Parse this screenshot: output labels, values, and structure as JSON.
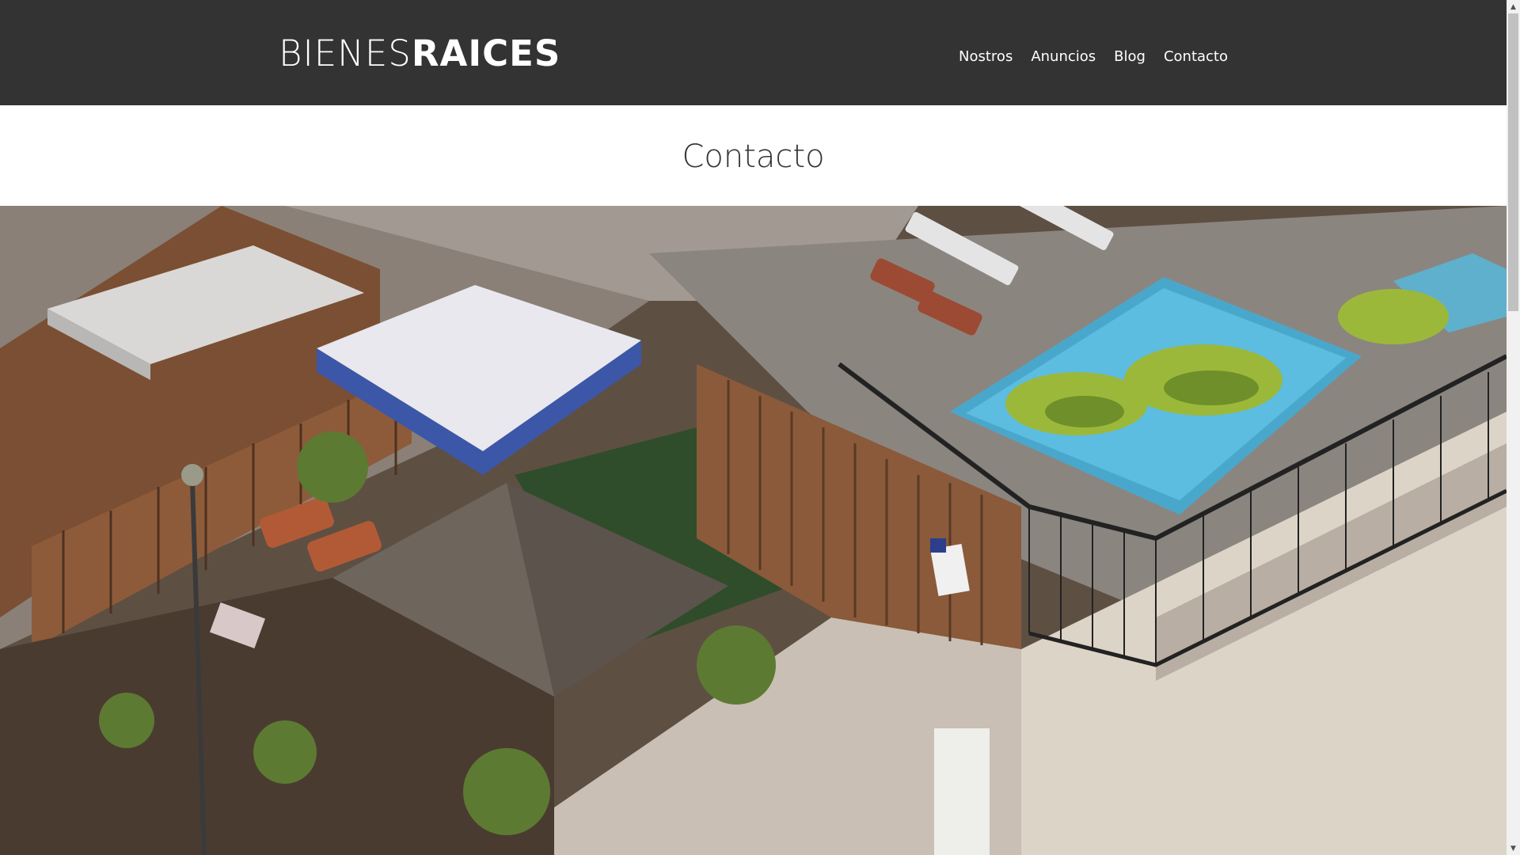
{
  "header": {
    "logo_light": "BIENES",
    "logo_bold": "RAICES",
    "nav": [
      {
        "label": "Nostros"
      },
      {
        "label": "Anuncios"
      },
      {
        "label": "Blog"
      },
      {
        "label": "Contacto"
      }
    ]
  },
  "page": {
    "title": "Contacto"
  },
  "colors": {
    "header_bg": "#333333",
    "text_light": "#ffffff",
    "text_dark": "#333333"
  }
}
